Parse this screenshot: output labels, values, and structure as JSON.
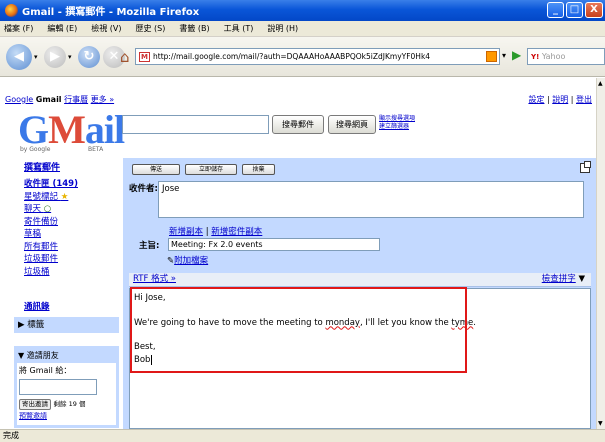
{
  "window": {
    "title": "Gmail - 撰寫郵件 - Mozilla Firefox",
    "buttons": [
      "_",
      "□",
      "X"
    ]
  },
  "menu": [
    "檔案 (F)",
    "編輯 (E)",
    "檢視 (V)",
    "歷史 (S)",
    "書籤 (B)",
    "工具 (T)",
    "說明 (H)"
  ],
  "address": {
    "url": "http://mail.google.com/mail/?auth=DQAAAHoAAABPQOk5iZdJKmyYF0Hk4",
    "search_placeholder": "Yahoo"
  },
  "gmail": {
    "toplinks": {
      "google": "Google",
      "gmail": "Gmail",
      "calendar": "行事曆",
      "more": "更多 »"
    },
    "rightlinks": {
      "settings": "設定",
      "help": "說明",
      "signout": "登出"
    },
    "logo": {
      "text_g": "G",
      "text_m": "M",
      "text_ail": "ail",
      "by": "by Google",
      "beta": "BETA"
    },
    "search_mail_button": "搜尋郵件",
    "search_web_button": "搜尋網頁",
    "search_options_link": "顯示搜尋選項",
    "create_filter_link": "建立篩選器"
  },
  "leftnav": {
    "compose": "撰寫郵件",
    "items": [
      "收件匣 (149)",
      "星號標記",
      "聊天",
      "寄件備份",
      "草稿",
      "所有郵件",
      "垃圾郵件",
      "垃圾桶"
    ],
    "contacts": "通訊錄",
    "labels": "標籤",
    "invite": {
      "title": "邀請朋友",
      "prompt": "將 Gmail 給：",
      "send_button": "寄出邀請",
      "remaining": "剩餘 19 個",
      "preview_link": "預覽邀請"
    }
  },
  "compose": {
    "buttons": [
      "傳送",
      "立即儲存",
      "捨棄"
    ],
    "to_label": "收件者:",
    "to_value": "Jose",
    "add_cc": "新增副本",
    "add_bcc": "新增密件副本",
    "subject_label": "主旨:",
    "subject_value": "Meeting: Fx 2.0 events",
    "attach": "附加檔案",
    "rtf": "RTF 格式 »",
    "spellcheck": "檢查拼字",
    "body": {
      "line1": "Hi Jose,",
      "line2a": "We're going to have to move the meeting to ",
      "line2b": "monday",
      "line2c": ", I'll let you know the ",
      "line2d": "tyme",
      "line2e": ".",
      "line3": "Best,",
      "line4": "Bob"
    }
  },
  "status": "完成"
}
